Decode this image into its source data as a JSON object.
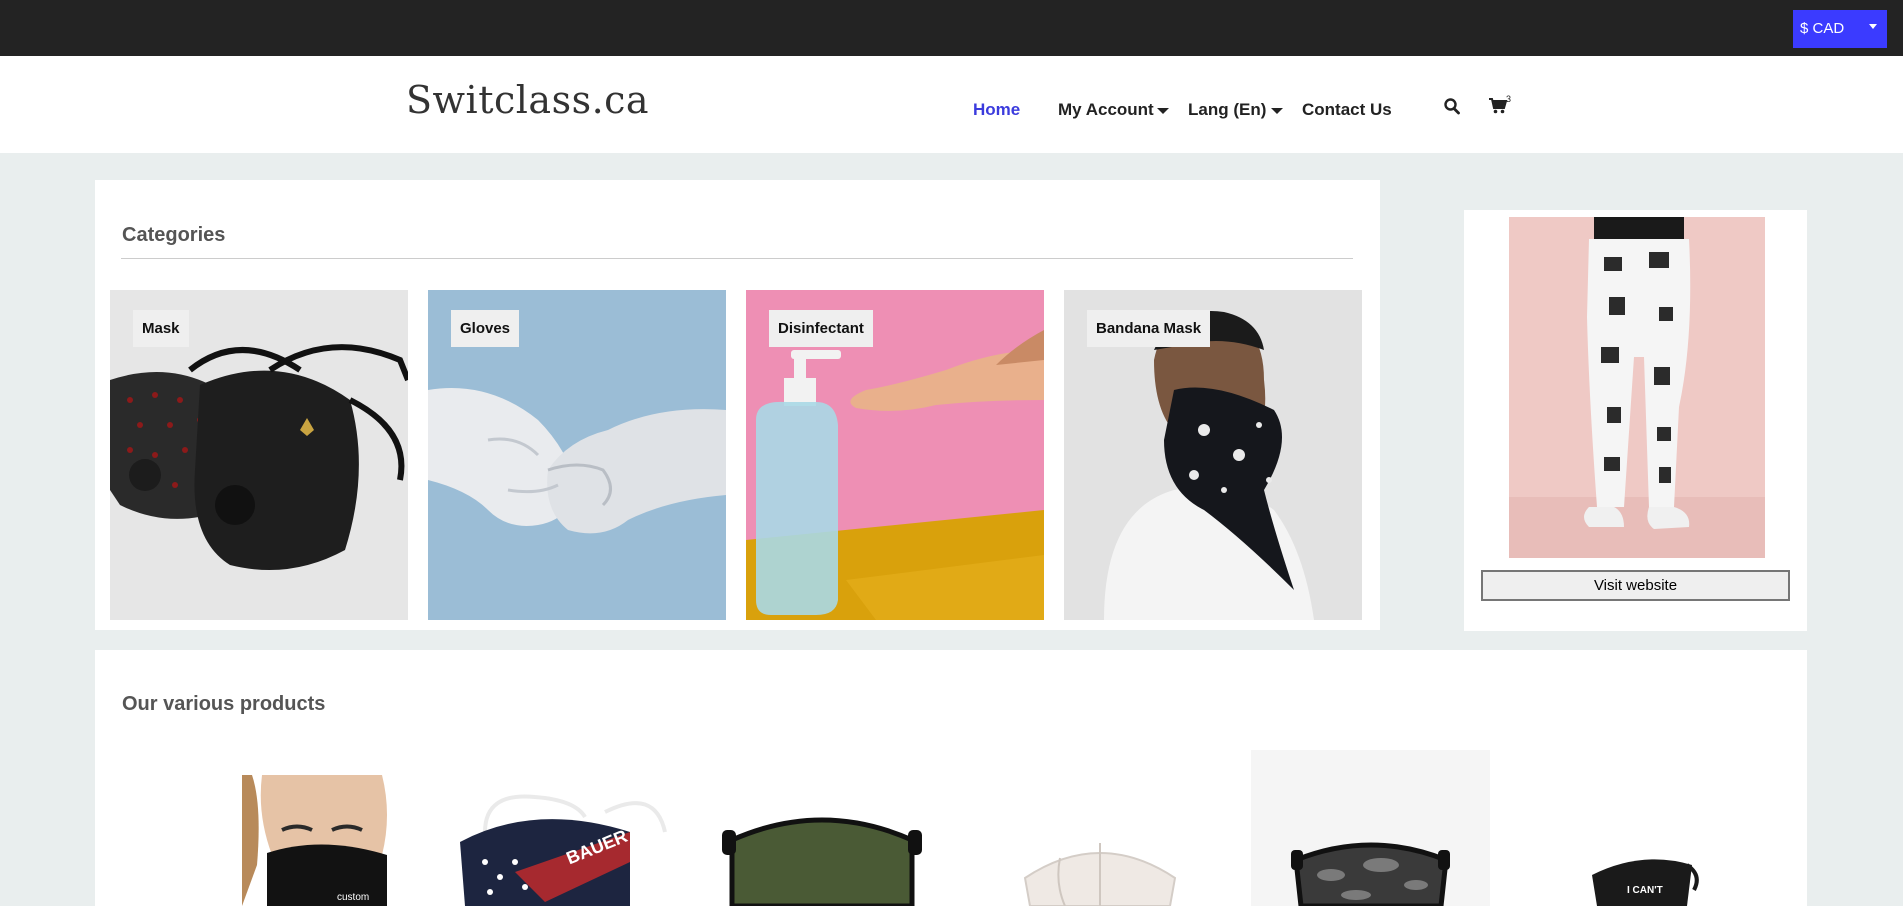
{
  "topbar": {
    "currency_label": "$ CAD"
  },
  "header": {
    "logo": "Switclass.ca",
    "cart_count": "3"
  },
  "nav": {
    "home": "Home",
    "my_account": "My Account",
    "lang": "Lang (En)",
    "contact": "Contact Us"
  },
  "categories": {
    "title": "Categories",
    "items": [
      {
        "label": "Mask"
      },
      {
        "label": "Gloves"
      },
      {
        "label": "Disinfectant"
      },
      {
        "label": "Bandana Mask"
      }
    ]
  },
  "ad": {
    "button_label": "Visit website"
  },
  "products": {
    "title": "Our various products",
    "items": [
      {
        "text": "custom"
      },
      {
        "text": "BAUER"
      },
      {
        "text": ""
      },
      {
        "text": ""
      },
      {
        "text": ""
      },
      {
        "text": "I CAN'T"
      }
    ]
  },
  "colors": {
    "topbar": "#232323",
    "accent": "#3b3bff",
    "nav_active": "#3b3bdd",
    "background": "#e9eeee"
  }
}
